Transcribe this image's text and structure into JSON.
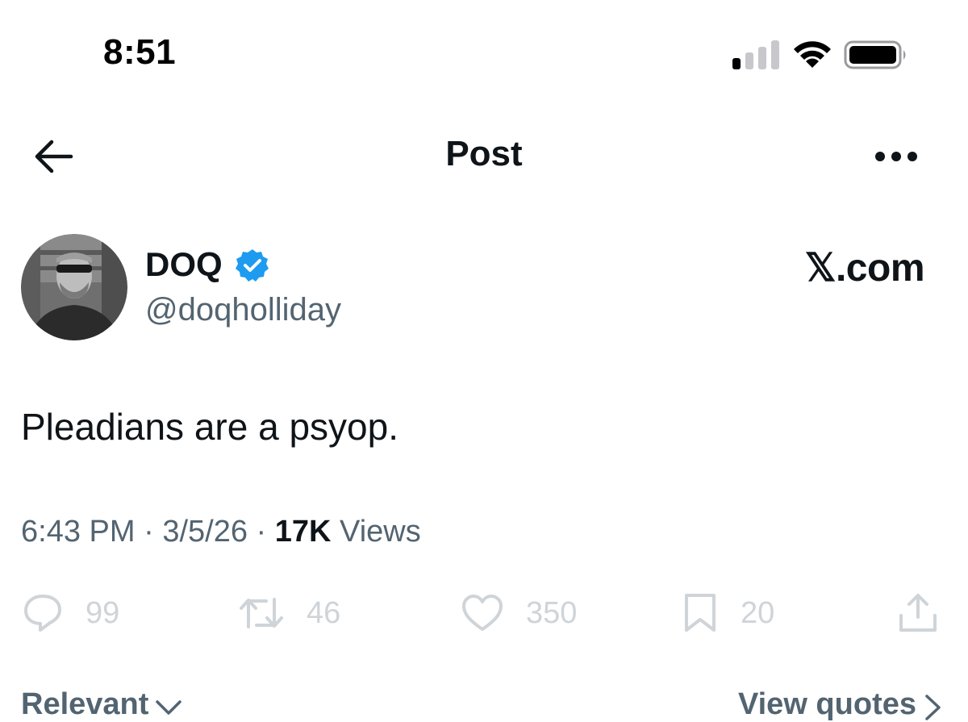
{
  "status_bar": {
    "time": "8:51"
  },
  "header": {
    "title": "Post",
    "back_icon": "arrow-left-icon",
    "more_icon": "ellipsis-icon"
  },
  "author": {
    "display_name": "DOQ",
    "handle": "@doqholliday",
    "verified": true,
    "brand": "𝕏.com"
  },
  "post": {
    "text": "Pleadians are a psyop.",
    "time": "6:43 PM",
    "separator": "·",
    "date": "3/5/26",
    "views_count": "17K",
    "views_label": "Views"
  },
  "actions": {
    "replies": "99",
    "reposts": "46",
    "likes": "350",
    "bookmarks": "20"
  },
  "footer": {
    "sort_label": "Relevant",
    "view_quotes": "View quotes"
  },
  "colors": {
    "text_primary": "#0f1419",
    "text_secondary": "#536471",
    "action_muted": "#cfd4d8",
    "verified_blue": "#1d9bf0"
  }
}
